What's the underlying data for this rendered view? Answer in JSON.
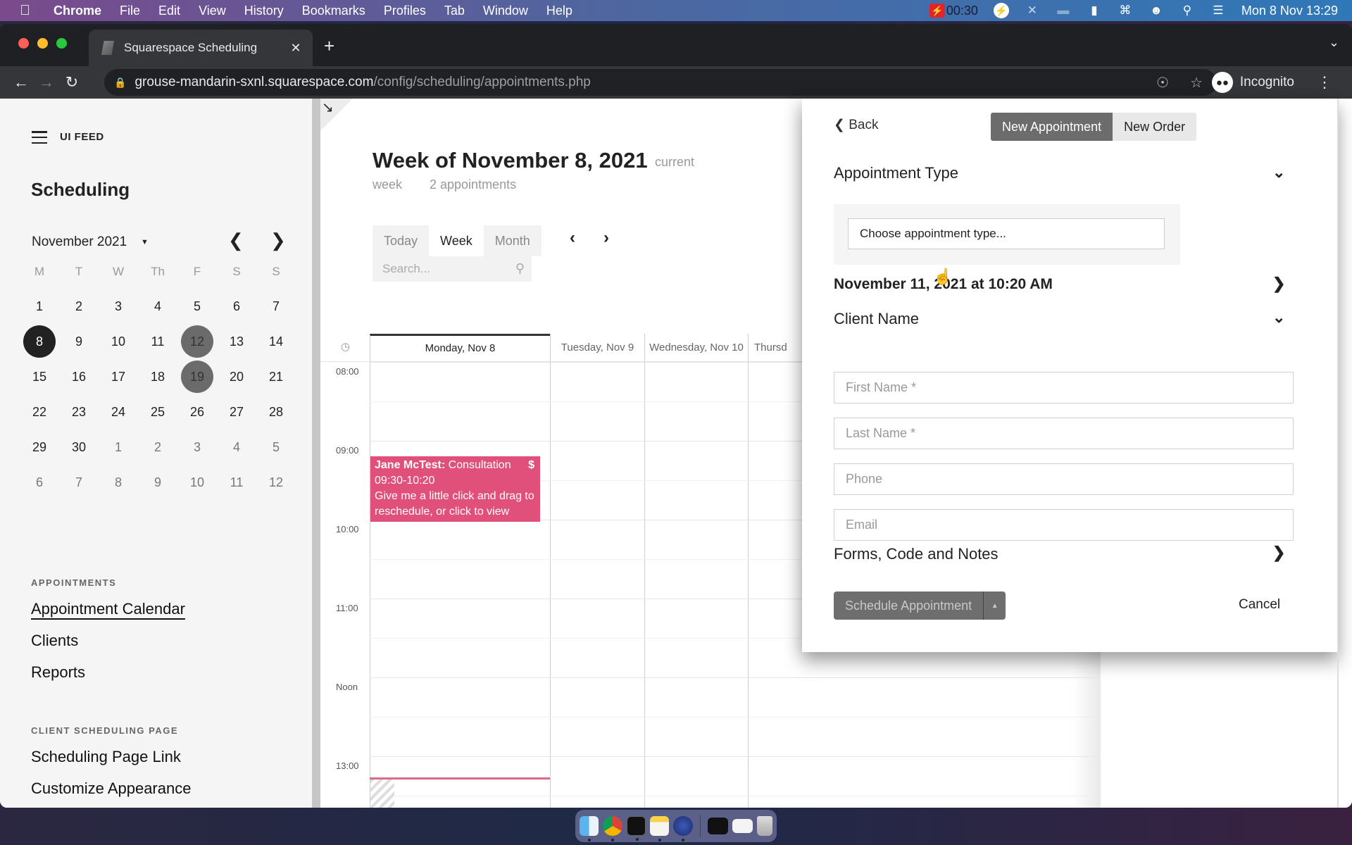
{
  "menubar": {
    "app": "Chrome",
    "items": [
      "File",
      "Edit",
      "View",
      "History",
      "Bookmarks",
      "Profiles",
      "Tab",
      "Window",
      "Help"
    ],
    "recording_time": "00:30",
    "datetime": "Mon 8 Nov  13:29",
    "status_icons": [
      "bolt-icon",
      "bluetooth-off-icon",
      "dock-icon",
      "battery-charging-icon",
      "wifi-icon",
      "user-icon",
      "search-icon",
      "control-center-icon"
    ]
  },
  "browser": {
    "tab_title": "Squarespace Scheduling",
    "url_host": "grouse-mandarin-sxnl.squarespace.com",
    "url_path": "/config/scheduling/appointments.php",
    "profile_label": "Incognito"
  },
  "sidebar": {
    "site_name": "UI FEED",
    "title": "Scheduling",
    "month_label": "November 2021",
    "weekdays": [
      "M",
      "T",
      "W",
      "Th",
      "F",
      "S",
      "S"
    ],
    "weeks": [
      [
        {
          "d": "1"
        },
        {
          "d": "2"
        },
        {
          "d": "3"
        },
        {
          "d": "4"
        },
        {
          "d": "5"
        },
        {
          "d": "6"
        },
        {
          "d": "7"
        }
      ],
      [
        {
          "d": "8",
          "state": "today"
        },
        {
          "d": "9"
        },
        {
          "d": "10"
        },
        {
          "d": "11"
        },
        {
          "d": "12",
          "state": "marked"
        },
        {
          "d": "13"
        },
        {
          "d": "14"
        }
      ],
      [
        {
          "d": "15"
        },
        {
          "d": "16"
        },
        {
          "d": "17"
        },
        {
          "d": "18"
        },
        {
          "d": "19",
          "state": "marked"
        },
        {
          "d": "20"
        },
        {
          "d": "21"
        }
      ],
      [
        {
          "d": "22"
        },
        {
          "d": "23"
        },
        {
          "d": "24"
        },
        {
          "d": "25"
        },
        {
          "d": "26"
        },
        {
          "d": "27"
        },
        {
          "d": "28"
        }
      ],
      [
        {
          "d": "29"
        },
        {
          "d": "30"
        },
        {
          "d": "1",
          "state": "other"
        },
        {
          "d": "2",
          "state": "other"
        },
        {
          "d": "3",
          "state": "other"
        },
        {
          "d": "4",
          "state": "other"
        },
        {
          "d": "5",
          "state": "other"
        }
      ],
      [
        {
          "d": "6",
          "state": "other"
        },
        {
          "d": "7",
          "state": "other"
        },
        {
          "d": "8",
          "state": "other"
        },
        {
          "d": "9",
          "state": "other"
        },
        {
          "d": "10",
          "state": "other"
        },
        {
          "d": "11",
          "state": "other"
        },
        {
          "d": "12",
          "state": "other"
        }
      ]
    ],
    "appointments_heading": "APPOINTMENTS",
    "appointments_links": [
      "Appointment Calendar",
      "Clients",
      "Reports"
    ],
    "client_page_heading": "CLIENT SCHEDULING PAGE",
    "client_page_links": [
      "Scheduling Page Link",
      "Customize Appearance"
    ]
  },
  "calendar": {
    "week_title": "Week of November 8, 2021",
    "current_week_part1": "current",
    "current_week_part2": "week",
    "appointment_count": "2 appointments",
    "views": [
      "Today",
      "Week",
      "Month"
    ],
    "active_view": "Week",
    "search_placeholder": "Search...",
    "columns": [
      "Monday, Nov 8",
      "Tuesday, Nov 9",
      "Wednesday, Nov 10",
      "Thursd"
    ],
    "time_labels": [
      "08:00",
      "09:00",
      "10:00",
      "11:00",
      "Noon",
      "13:00"
    ],
    "event": {
      "client": "Jane McTest:",
      "type": "Consultation",
      "time": "09:30-10:20",
      "hint": "Give me a little click and drag to reschedule, or click to view",
      "badge": "$",
      "color": "#e0507a"
    }
  },
  "panel": {
    "back_label": "Back",
    "tabs": [
      "New Appointment",
      "New Order"
    ],
    "appointment_type_heading": "Appointment Type",
    "appointment_type_value": "Choose appointment type...",
    "datetime": "November 11, 2021 at 10:20 AM",
    "client_name_heading": "Client Name",
    "fields": {
      "first_name": "First Name *",
      "last_name": "Last Name *",
      "phone": "Phone",
      "email": "Email"
    },
    "forms_heading": "Forms, Code and Notes",
    "schedule_button": "Schedule Appointment",
    "cancel_button": "Cancel"
  },
  "dock": {
    "apps": [
      "finder",
      "chrome",
      "terminal",
      "notes",
      "reeder",
      "window-1",
      "window-2",
      "trash"
    ]
  }
}
